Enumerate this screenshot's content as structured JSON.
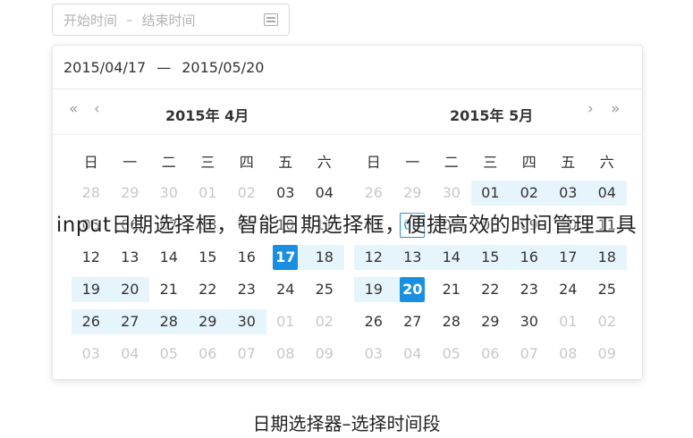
{
  "range_input": {
    "start_placeholder": "开始时间",
    "separator": "–",
    "end_placeholder": "结束时间"
  },
  "panel": {
    "start_date": "2015/04/17",
    "separator": "—",
    "end_date": "2015/05/20"
  },
  "nav": {
    "prev_year": "«",
    "prev_month": "‹",
    "next_month": "›",
    "next_year": "»"
  },
  "left_month": {
    "title": "2015年 4月",
    "weekdays": [
      "日",
      "一",
      "二",
      "三",
      "四",
      "五",
      "六"
    ],
    "weeks": [
      [
        {
          "d": "28",
          "m": 1
        },
        {
          "d": "29",
          "m": 1
        },
        {
          "d": "30",
          "m": 1
        },
        {
          "d": "01",
          "m": 1
        },
        {
          "d": "02",
          "m": 1
        },
        {
          "d": "03"
        },
        {
          "d": "04"
        }
      ],
      [
        {
          "d": "05"
        },
        {
          "d": "06"
        },
        {
          "d": "07"
        },
        {
          "d": "08"
        },
        {
          "d": "09"
        },
        {
          "d": "10"
        },
        {
          "d": "11"
        }
      ],
      [
        {
          "d": "12"
        },
        {
          "d": "13"
        },
        {
          "d": "14"
        },
        {
          "d": "15"
        },
        {
          "d": "16"
        },
        {
          "d": "17",
          "s": "sel-start"
        },
        {
          "d": "18",
          "r": 1
        }
      ],
      [
        {
          "d": "19",
          "r": 1
        },
        {
          "d": "20",
          "r": 1
        },
        {
          "d": "21"
        },
        {
          "d": "22"
        },
        {
          "d": "23"
        },
        {
          "d": "24"
        },
        {
          "d": "25"
        }
      ],
      [
        {
          "d": "26",
          "r": 1
        },
        {
          "d": "27",
          "r": 1
        },
        {
          "d": "28",
          "r": 1
        },
        {
          "d": "29",
          "r": 1
        },
        {
          "d": "30",
          "r": 1
        },
        {
          "d": "01",
          "m": 1
        },
        {
          "d": "02",
          "m": 1
        }
      ],
      [
        {
          "d": "03",
          "m": 1
        },
        {
          "d": "04",
          "m": 1
        },
        {
          "d": "05",
          "m": 1
        },
        {
          "d": "06",
          "m": 1
        },
        {
          "d": "07",
          "m": 1
        },
        {
          "d": "08",
          "m": 1
        },
        {
          "d": "09",
          "m": 1
        }
      ]
    ]
  },
  "right_month": {
    "title": "2015年 5月",
    "weekdays": [
      "日",
      "一",
      "二",
      "三",
      "四",
      "五",
      "六"
    ],
    "weeks": [
      [
        {
          "d": "26",
          "m": 1
        },
        {
          "d": "29",
          "m": 1
        },
        {
          "d": "30",
          "m": 1
        },
        {
          "d": "01",
          "r": 1
        },
        {
          "d": "02",
          "r": 1
        },
        {
          "d": "03",
          "r": 1
        },
        {
          "d": "04",
          "r": 1
        }
      ],
      [
        {
          "d": "05"
        },
        {
          "d": "06",
          "t": 1
        },
        {
          "d": "07"
        },
        {
          "d": "08"
        },
        {
          "d": "09"
        },
        {
          "d": "10"
        },
        {
          "d": "11"
        }
      ],
      [
        {
          "d": "12",
          "r": 1
        },
        {
          "d": "13",
          "r": 1
        },
        {
          "d": "14",
          "r": 1
        },
        {
          "d": "15",
          "r": 1
        },
        {
          "d": "16",
          "r": 1
        },
        {
          "d": "17",
          "r": 1
        },
        {
          "d": "18",
          "r": 1
        }
      ],
      [
        {
          "d": "19",
          "r": 1
        },
        {
          "d": "20",
          "s": "sel-end"
        },
        {
          "d": "21"
        },
        {
          "d": "22"
        },
        {
          "d": "23"
        },
        {
          "d": "24"
        },
        {
          "d": "25"
        }
      ],
      [
        {
          "d": "26"
        },
        {
          "d": "27"
        },
        {
          "d": "28"
        },
        {
          "d": "29"
        },
        {
          "d": "30"
        },
        {
          "d": "01",
          "m": 1
        },
        {
          "d": "02",
          "m": 1
        }
      ],
      [
        {
          "d": "03",
          "m": 1
        },
        {
          "d": "04",
          "m": 1
        },
        {
          "d": "05",
          "m": 1
        },
        {
          "d": "06",
          "m": 1
        },
        {
          "d": "07",
          "m": 1
        },
        {
          "d": "08",
          "m": 1
        },
        {
          "d": "09",
          "m": 1
        }
      ]
    ]
  },
  "overlay_text": "input日期选择框，智能日期选择框，便捷高效的时间管理工具",
  "caption": "日期选择器–选择时间段",
  "colors": {
    "accent": "#1a8fe2",
    "range_bg": "#e6f4fb"
  }
}
